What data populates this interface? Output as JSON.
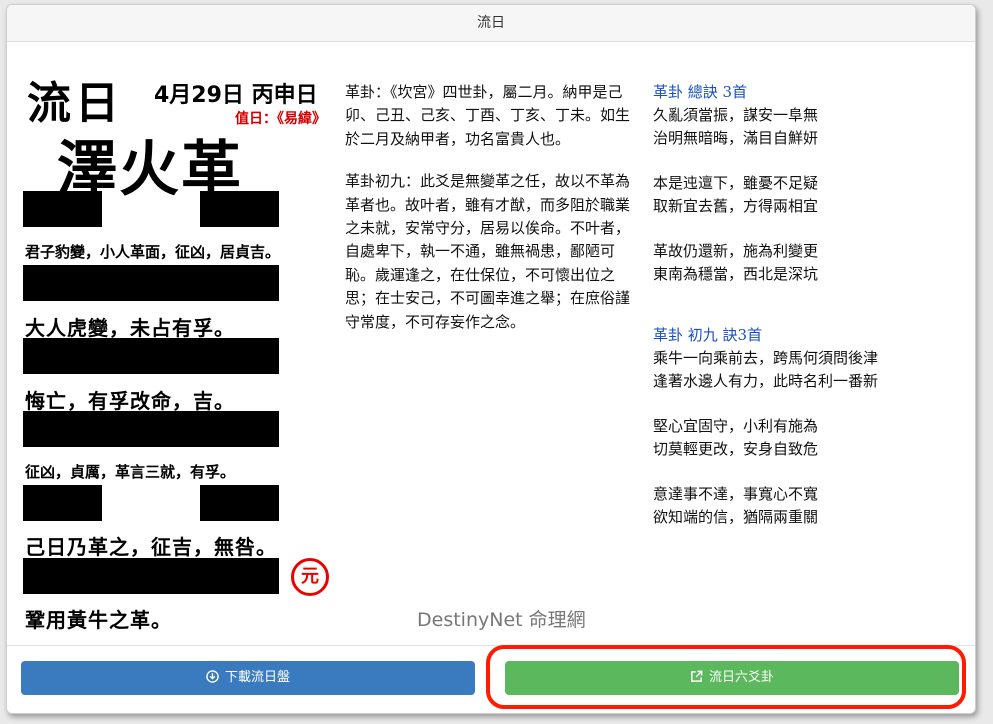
{
  "window": {
    "title": "流日"
  },
  "header": {
    "big_title": "流日",
    "date": "4月29日 丙申日",
    "zhiri": "值日：《易緯》",
    "hexagram_name": "澤火革"
  },
  "lines": [
    {
      "kind": "broken",
      "text": "君子豹變，小人革面，征凶，居貞吉。",
      "size": "small"
    },
    {
      "kind": "solid",
      "text": "大人虎變，未占有孚。",
      "size": "big"
    },
    {
      "kind": "solid",
      "text": "悔亡，有孚改命，吉。",
      "size": "big"
    },
    {
      "kind": "solid",
      "text": "征凶，貞厲，革言三就，有孚。",
      "size": "small"
    },
    {
      "kind": "broken",
      "text": "己日乃革之，征吉，無咎。",
      "size": "big"
    },
    {
      "kind": "solid",
      "text": "鞏用黃牛之革。",
      "size": "big",
      "mark": "元"
    }
  ],
  "middle": {
    "para1": "革卦：《坎宮》四世卦，屬二月。納甲是己卯、己丑、己亥、丁酉、丁亥、丁未。如生於二月及納甲者，功名富貴人也。",
    "para2": "革卦初九：此爻是無變革之任，故以不革為革者也。故叶者，雖有才猷，而多阻於職業之未就，安常守分，居易以俟命。不叶者，自處卑下，執一不通，雖無禍患，鄙陋可恥。歲運逢之，在仕保位，不可懷出位之思；在士安己，不可圖幸進之舉；在庶俗謹守常度，不可存妄作之念。"
  },
  "right": {
    "heading1": "革卦 總訣 3首",
    "poems1": [
      [
        "久亂須當振，謀安一阜無",
        "治明無暗晦，滿目自鮮妍"
      ],
      [
        "本是迍邅下，雖憂不足疑",
        "取新宜去舊，方得兩相宜"
      ],
      [
        "革故仍還新，施為利變更",
        "東南為穩當，西北是深坑"
      ]
    ],
    "heading2": "革卦 初九 訣3首",
    "poems2": [
      [
        "乘牛一向乘前去，跨馬何須問後津",
        "逢著水邊人有力，此時名利一番新"
      ],
      [
        "堅心宜固守，小利有施為",
        "切莫輕更改，安身自致危"
      ],
      [
        "意達事不達，事寬心不寬",
        "欲知端的信，猶隔兩重關"
      ]
    ]
  },
  "watermark": "DestinyNet 命理網",
  "buttons": {
    "download": "下載流日盤",
    "download_icon": "download-circle-icon",
    "liuyao": "流日六爻卦",
    "liuyao_icon": "external-link-icon"
  },
  "colors": {
    "red": "#d40000",
    "link_blue": "#1a4fc9",
    "button_blue": "#3a7bbf",
    "button_green": "#5cb85c",
    "highlight": "#ff1a00"
  }
}
